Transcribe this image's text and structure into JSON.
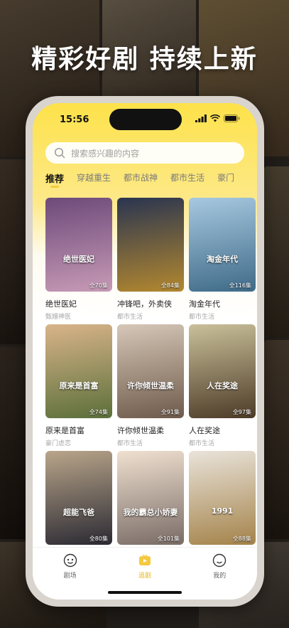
{
  "headline": "精彩好剧  持续上新",
  "status_bar": {
    "time": "15:56"
  },
  "search": {
    "placeholder": "搜索感兴趣的内容"
  },
  "tabs": [
    {
      "label": "推荐"
    },
    {
      "label": "穿越重生"
    },
    {
      "label": "都市战神"
    },
    {
      "label": "都市生活"
    },
    {
      "label": "豪门"
    }
  ],
  "dramas": [
    {
      "title": "绝世医妃",
      "tag": "甄嬛神医",
      "episodes": "全70集",
      "poster_text": "绝世医妃",
      "color_top": "#6d4a7a",
      "color_bottom": "#c79ab6"
    },
    {
      "title": "冲锋吧，外卖侠",
      "tag": "都市生活",
      "episodes": "全84集",
      "poster_text": "",
      "color_top": "#2a3550",
      "color_bottom": "#b3882f"
    },
    {
      "title": "淘金年代",
      "tag": "都市生活",
      "episodes": "全116集",
      "poster_text": "淘金年代",
      "color_top": "#a7c8e0",
      "color_bottom": "#3f6b88"
    },
    {
      "title": "原来是首富",
      "tag": "豪门虐恋",
      "episodes": "全74集",
      "poster_text": "原来是首富",
      "color_top": "#d9b48a",
      "color_bottom": "#5b6f3a"
    },
    {
      "title": "许你倾世温柔",
      "tag": "都市生活",
      "episodes": "全91集",
      "poster_text": "许你倾世温柔",
      "color_top": "#d6c7b8",
      "color_bottom": "#6e5a4a"
    },
    {
      "title": "人在奖途",
      "tag": "都市生活",
      "episodes": "全97集",
      "poster_text": "人在奖途",
      "color_top": "#c9c09a",
      "color_bottom": "#4d3b27"
    },
    {
      "title": "超能飞爸",
      "tag": "",
      "episodes": "全80集",
      "poster_text": "超能飞爸",
      "color_top": "#b9a58a",
      "color_bottom": "#2b2a33"
    },
    {
      "title": "我的霸总小娇妻",
      "tag": "",
      "episodes": "全101集",
      "poster_text": "我的霸总小娇妻",
      "color_top": "#efe0d0",
      "color_bottom": "#7a6c66"
    },
    {
      "title": "1991",
      "tag": "",
      "episodes": "全88集",
      "poster_text": "1991",
      "color_top": "#e9e3da",
      "color_bottom": "#a4834a"
    }
  ],
  "tabbar": [
    {
      "label": "剧场",
      "icon": "theater-icon"
    },
    {
      "label": "追剧",
      "icon": "tv-icon"
    },
    {
      "label": "我的",
      "icon": "profile-icon"
    }
  ],
  "colors": {
    "accent": "#fde24a",
    "tab_active": "#e9b81e"
  }
}
